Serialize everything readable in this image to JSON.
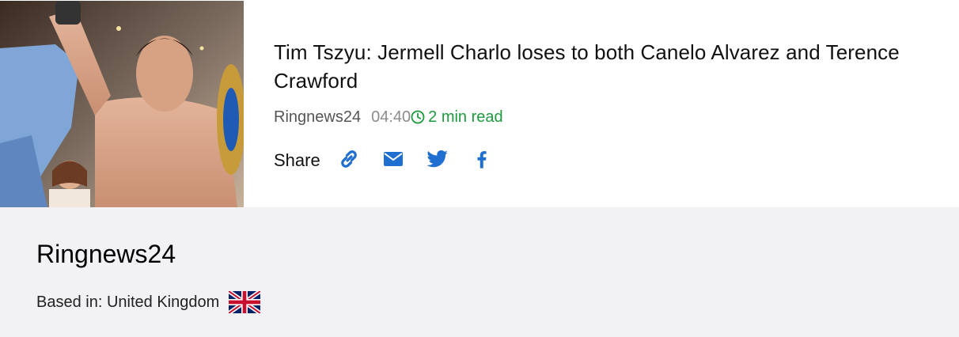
{
  "article": {
    "headline": "Tim Tszyu: Jermell Charlo loses to both Canelo Alvarez and Terence Crawford",
    "source": "Ringnews24",
    "time": "04:40",
    "read_time": "2 min read",
    "thumbnail_icon": "boxer-photo",
    "share": {
      "label": "Share",
      "buttons": [
        {
          "name": "copy-link",
          "icon": "link-icon"
        },
        {
          "name": "email",
          "icon": "envelope-icon"
        },
        {
          "name": "twitter",
          "icon": "twitter-icon"
        },
        {
          "name": "facebook",
          "icon": "facebook-icon"
        }
      ]
    }
  },
  "profile": {
    "name": "Ringnews24",
    "based_in": "Based in: United Kingdom",
    "flag_icon": "uk-flag-icon"
  },
  "colors": {
    "accent": "#1e6fd0",
    "read_time": "#1e9a3e",
    "profile_bg": "#f2f1f4"
  }
}
